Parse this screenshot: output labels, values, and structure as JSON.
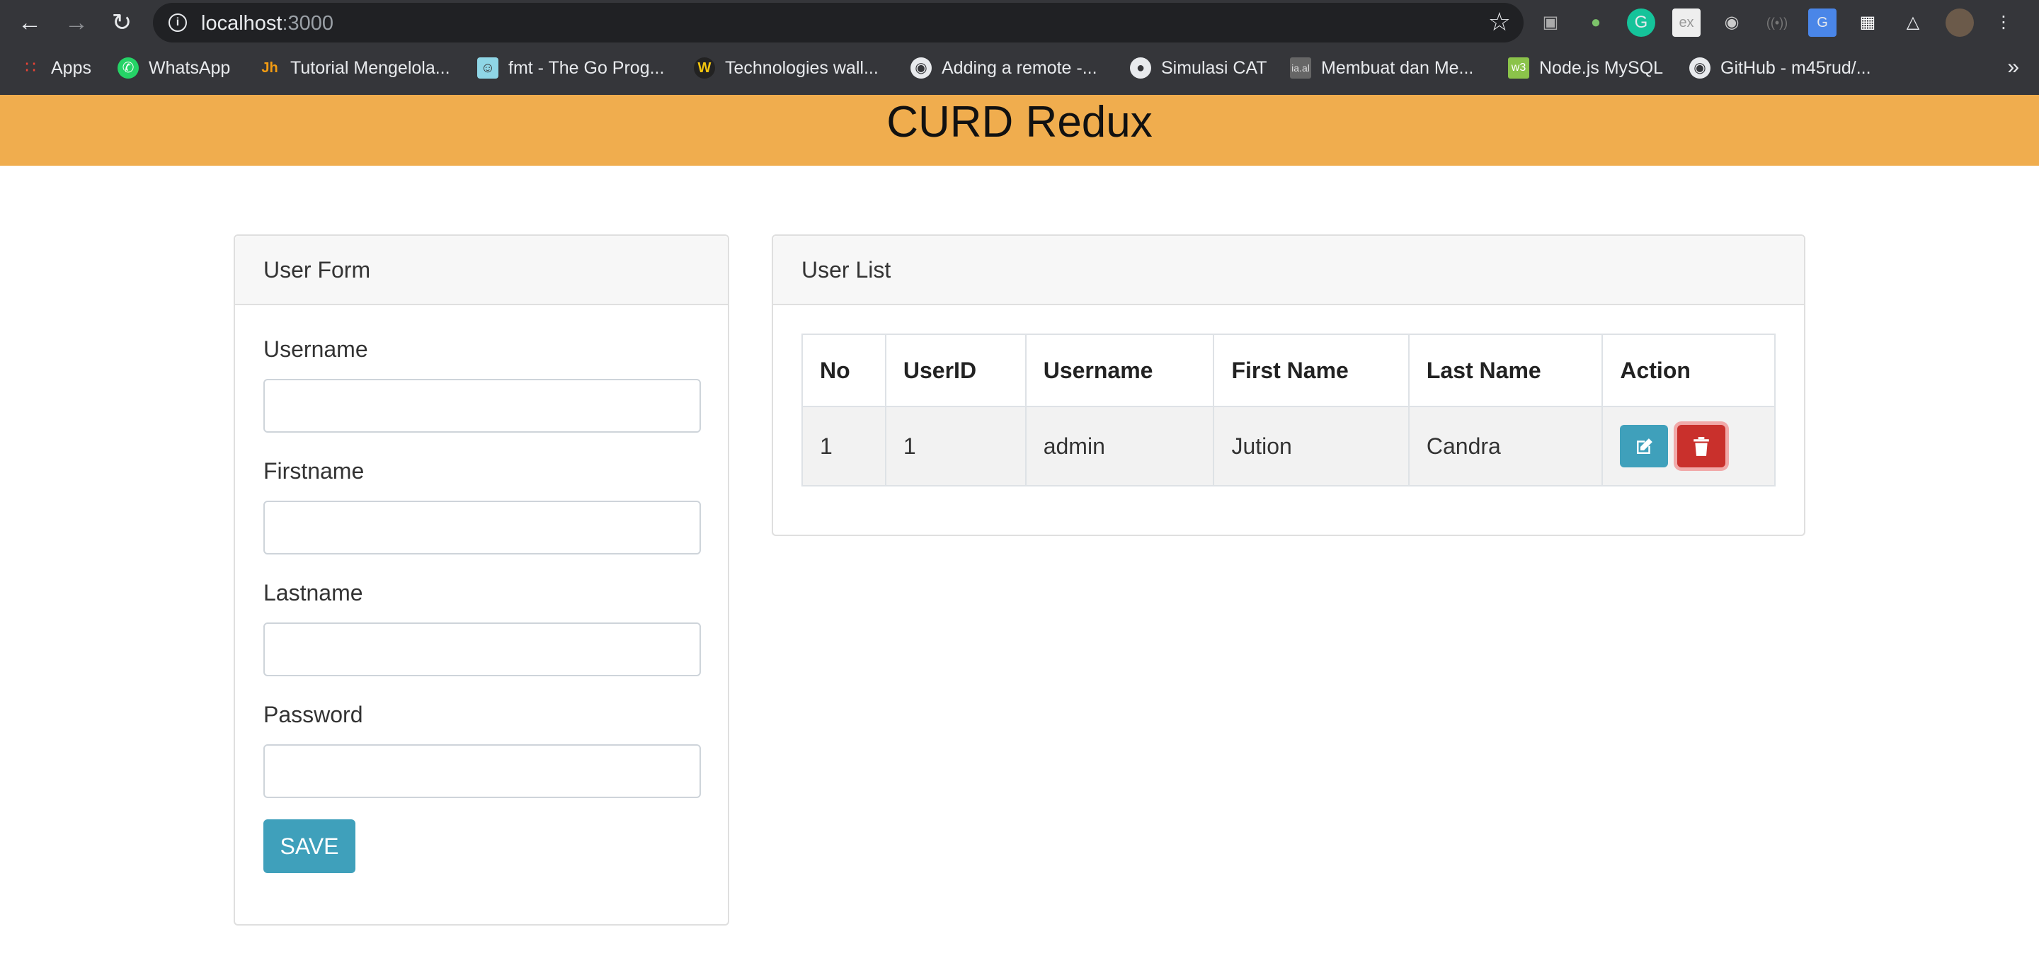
{
  "browser": {
    "url_host": "localhost",
    "url_port": ":3000",
    "bookmarks": [
      {
        "label": "Apps",
        "icon": "apps-grid-icon"
      },
      {
        "label": "WhatsApp",
        "icon": "whatsapp-icon"
      },
      {
        "label": "Tutorial Mengelola...",
        "icon": "jh-logo-icon"
      },
      {
        "label": "fmt - The Go Prog...",
        "icon": "gopher-icon"
      },
      {
        "label": "Technologies wall...",
        "icon": "w-logo-icon"
      },
      {
        "label": "Adding a remote -...",
        "icon": "github-icon"
      },
      {
        "label": "Simulasi CAT",
        "icon": "globe-icon"
      },
      {
        "label": "Membuat dan Me...",
        "icon": "site-icon"
      },
      {
        "label": "Node.js MySQL",
        "icon": "w3-icon"
      },
      {
        "label": "GitHub - m45rud/...",
        "icon": "github-icon"
      }
    ],
    "more": "»"
  },
  "header": {
    "title": "CURD Redux",
    "color": "#f0ad4e"
  },
  "form": {
    "title": "User Form",
    "fields": [
      {
        "label": "Username",
        "value": ""
      },
      {
        "label": "Firstname",
        "value": ""
      },
      {
        "label": "Lastname",
        "value": ""
      },
      {
        "label": "Password",
        "value": ""
      }
    ],
    "save_label": "SAVE"
  },
  "list": {
    "title": "User List",
    "columns": [
      "No",
      "UserID",
      "Username",
      "First Name",
      "Last Name",
      "Action"
    ],
    "rows": [
      {
        "no": "1",
        "userid": "1",
        "username": "admin",
        "firstname": "Jution",
        "lastname": "Candra"
      }
    ]
  },
  "colors": {
    "info": "#3fa0bb",
    "danger": "#c9302c"
  }
}
